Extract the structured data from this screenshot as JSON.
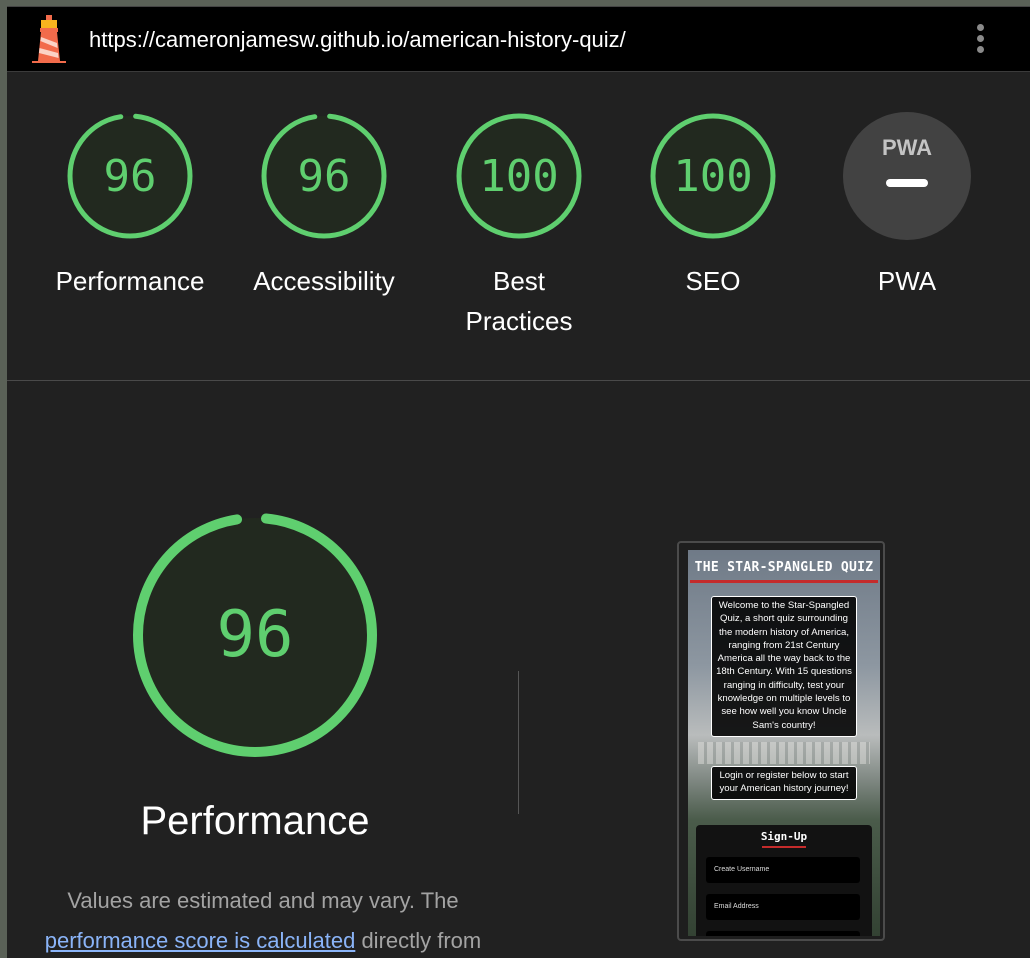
{
  "topbar": {
    "url": "https://cameronjamesw.github.io/american-history-quiz/",
    "logo_icon": "lighthouse-icon",
    "menu_icon": "kebab-menu-icon"
  },
  "gauges": [
    {
      "score": "96",
      "value": 96,
      "label": "Performance"
    },
    {
      "score": "96",
      "value": 96,
      "label": "Accessibility"
    },
    {
      "score": "100",
      "value": 100,
      "label": "Best Practices"
    },
    {
      "score": "100",
      "value": 100,
      "label": "SEO"
    },
    {
      "score": "PWA",
      "label": "PWA"
    }
  ],
  "performance": {
    "score": "96",
    "value": 96,
    "label": "Performance",
    "desc_prefix": "Values are estimated and may vary. The ",
    "desc_link": "performance score is calculated",
    "desc_suffix": " directly from"
  },
  "screenshot": {
    "title": "THE STAR-SPANGLED QUIZ",
    "intro": "Welcome to the Star-Spangled Quiz, a short quiz surrounding the modern history of America, ranging from 21st Century America all the way back to the 18th Century. With 15 questions ranging in difficulty, test your knowledge on multiple levels to see how well you know Uncle Sam's country!",
    "login_prompt": "Login or register below to start your American history journey!",
    "signup_title": "Sign-Up",
    "username_placeholder": "Create Username",
    "email_placeholder": "Email Address"
  },
  "colors": {
    "pass": "#5fcf6f",
    "gauge_bg": "#22291f",
    "pwa_bg": "#424242"
  }
}
